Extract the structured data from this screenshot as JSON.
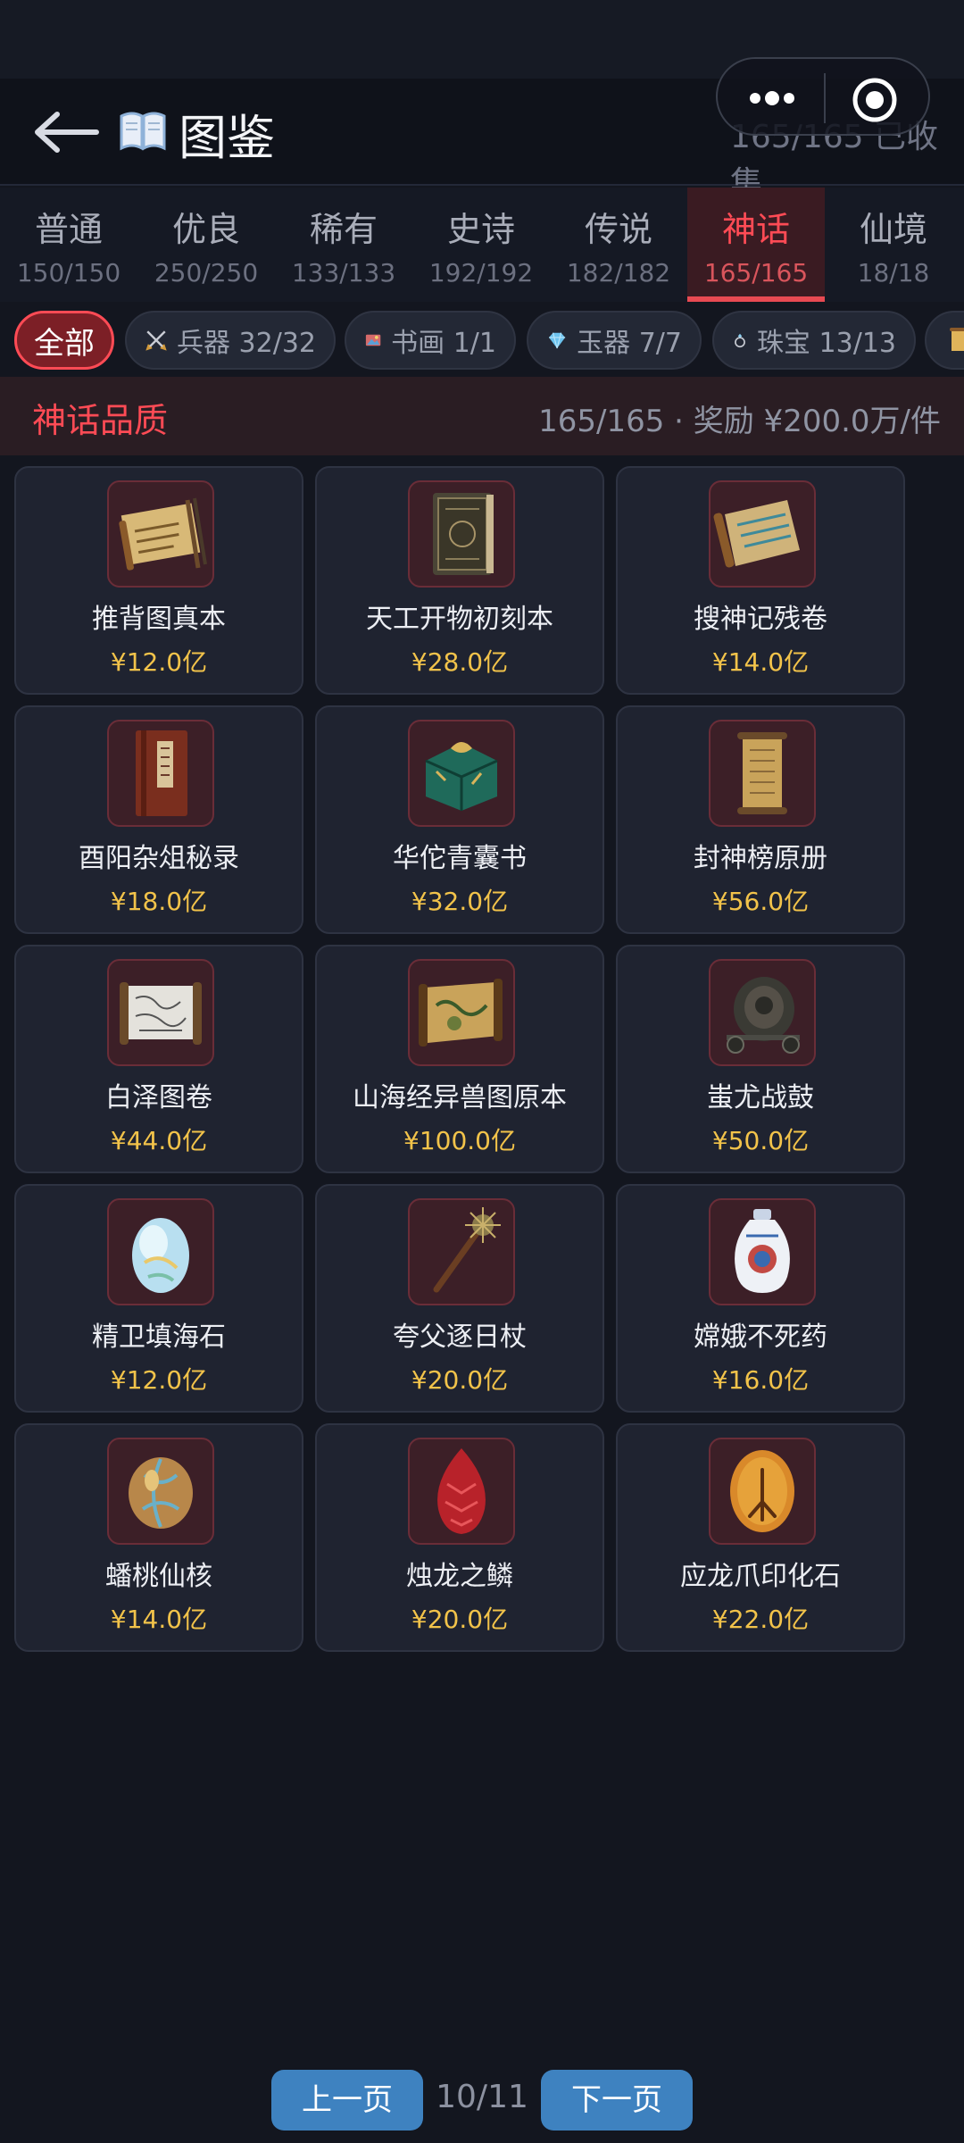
{
  "header": {
    "title": "图鉴",
    "collected": "165/165 已收集"
  },
  "quality_tabs": [
    {
      "name": "普通",
      "count": "150/150"
    },
    {
      "name": "优良",
      "count": "250/250"
    },
    {
      "name": "稀有",
      "count": "133/133"
    },
    {
      "name": "史诗",
      "count": "192/192"
    },
    {
      "name": "传说",
      "count": "182/182"
    },
    {
      "name": "神话",
      "count": "165/165",
      "active": true
    },
    {
      "name": "仙境",
      "count": "18/18"
    }
  ],
  "categories": [
    {
      "label": "全部",
      "active": true
    },
    {
      "label": "兵器 32/32",
      "icon": "swords-icon"
    },
    {
      "label": "书画 1/1",
      "icon": "painting-icon"
    },
    {
      "label": "玉器 7/7",
      "icon": "diamond-icon"
    },
    {
      "label": "珠宝 13/13",
      "icon": "ring-icon"
    },
    {
      "label": "",
      "icon": "scroll-icon"
    }
  ],
  "section": {
    "title": "神话品质",
    "meta": "165/165 · 奖励 ¥200.0万/件"
  },
  "items": [
    {
      "name": "推背图真本",
      "price": "¥12.0亿",
      "icon": "scroll-with-brushes-icon"
    },
    {
      "name": "天工开物初刻本",
      "price": "¥28.0亿",
      "icon": "ancient-book-icon"
    },
    {
      "name": "搜神记残卷",
      "price": "¥14.0亿",
      "icon": "torn-scroll-icon"
    },
    {
      "name": "酉阳杂俎秘录",
      "price": "¥18.0亿",
      "icon": "red-book-icon"
    },
    {
      "name": "华佗青囊书",
      "price": "¥32.0亿",
      "icon": "green-bundle-icon"
    },
    {
      "name": "封神榜原册",
      "price": "¥56.0亿",
      "icon": "hanging-scroll-icon"
    },
    {
      "name": "白泽图卷",
      "price": "¥44.0亿",
      "icon": "open-scroll-icon"
    },
    {
      "name": "山海经异兽图原本",
      "price": "¥100.0亿",
      "icon": "map-scroll-icon"
    },
    {
      "name": "蚩尤战鼓",
      "price": "¥50.0亿",
      "icon": "war-drum-icon"
    },
    {
      "name": "精卫填海石",
      "price": "¥12.0亿",
      "icon": "opal-stone-icon"
    },
    {
      "name": "夸父逐日杖",
      "price": "¥20.0亿",
      "icon": "staff-icon"
    },
    {
      "name": "嫦娥不死药",
      "price": "¥16.0亿",
      "icon": "porcelain-vase-icon"
    },
    {
      "name": "蟠桃仙核",
      "price": "¥14.0亿",
      "icon": "peach-seed-icon"
    },
    {
      "name": "烛龙之鳞",
      "price": "¥20.0亿",
      "icon": "red-scale-icon"
    },
    {
      "name": "应龙爪印化石",
      "price": "¥22.0亿",
      "icon": "amber-fossil-icon"
    }
  ],
  "pager": {
    "prev_label": "上一页",
    "page": "10/11",
    "next_label": "下一页"
  },
  "colors": {
    "accent_red": "#ff4b55",
    "price_gold": "#f2c34a",
    "button_blue": "#3e82c0"
  }
}
